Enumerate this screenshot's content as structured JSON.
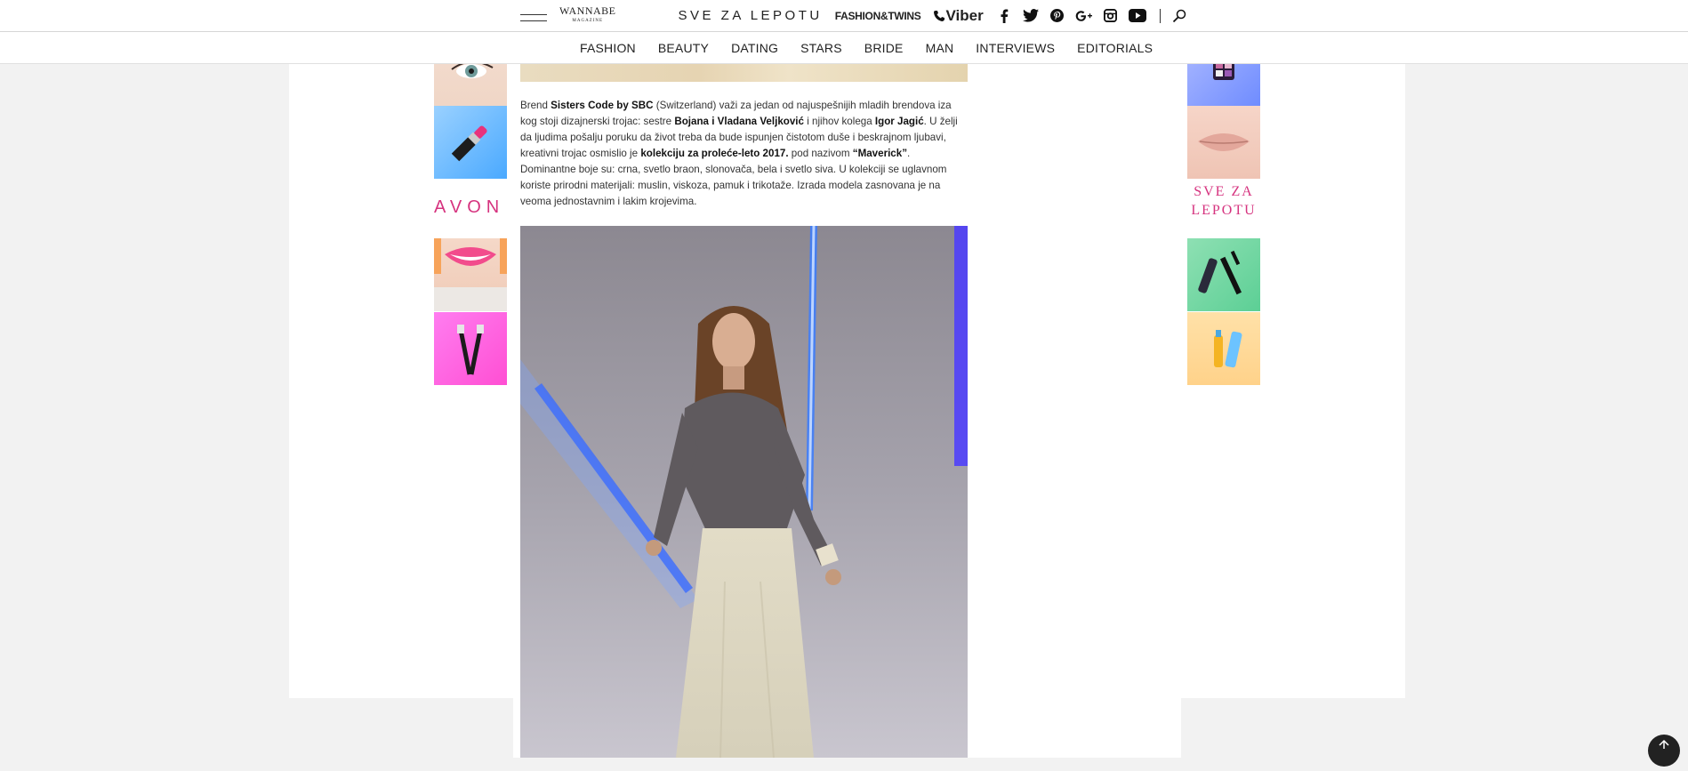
{
  "header": {
    "logo_wannabe": "WANNABE",
    "logo_wannabe_sub": "MAGAZINE",
    "logo_svezalepotu": "SVE ZA LEPOTU",
    "logo_fashiontwins": "FASHION&TWINS",
    "logo_viber": "Viber",
    "social": [
      "facebook-icon",
      "twitter-icon",
      "pinterest-icon",
      "google-plus-icon",
      "instagram-icon",
      "youtube-icon"
    ]
  },
  "nav": {
    "items": [
      "FASHION",
      "BEAUTY",
      "DATING",
      "STARS",
      "BRIDE",
      "MAN",
      "INTERVIEWS",
      "EDITORIALS"
    ]
  },
  "left_ads": {
    "avon_text": "AVON"
  },
  "right_ads": {
    "sve_za_lepotu_line1": "SVE ZA",
    "sve_za_lepotu_line2": "LEPOTU"
  },
  "article": {
    "p1_a": "Brend ",
    "p1_brand": "Sisters Code by SBC",
    "p1_b": " (Switzerland) važi za jedan od najuspešnijih mladih brendova iza kog stoji dizajnerski trojac: sestre ",
    "p1_sisters": "Bojana i Vladana Veljković",
    "p1_c": " i njihov kolega ",
    "p1_colleague": "Igor Jagić",
    "p1_d": ". U želji da ljudima pošalju poruku da život treba da bude ispunjen čistotom duše i beskrajnom ljubavi, kreativni trojac osmislio je ",
    "p1_collection": "kolekciju za proleće-leto 2017.",
    "p1_e": " pod nazivom ",
    "p1_name": "“Maverick”",
    "p1_f": ". Dominantne boje su: crna, svetlo braon, slonovača, bela i svetlo siva. U kolekciji se uglavnom koriste prirodni materijali: muslin, viskoza, pamuk i trikotaže. Izrada modela zasnovana je na veoma jednostavnim i lakim krojevima."
  },
  "colors": {
    "accent_pink": "#d6337f",
    "background": "#f2f2f2"
  }
}
